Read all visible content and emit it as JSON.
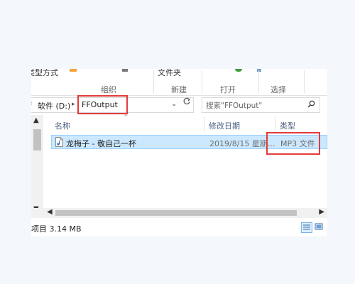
{
  "ribbon": {
    "partial_left": "类型方式",
    "partial_mid": "文件夹",
    "groups": {
      "organize": "组织",
      "new": "新建",
      "open": "打开",
      "select": "选择"
    }
  },
  "address": {
    "crumbs": [
      "软件 (D:)",
      "FFOutput"
    ],
    "search_placeholder": "搜索\"FFOutput\""
  },
  "columns": {
    "name": "名称",
    "date": "修改日期",
    "type": "类型"
  },
  "files": [
    {
      "name": "龙梅子 - 敬自己一杯",
      "date": "2019/8/15 星期...",
      "type": "MP3 文件"
    }
  ],
  "status": {
    "text": "项目 3.14 MB"
  },
  "colors": {
    "highlight": "#e23b3b",
    "selected_row": "#cce8ff"
  }
}
